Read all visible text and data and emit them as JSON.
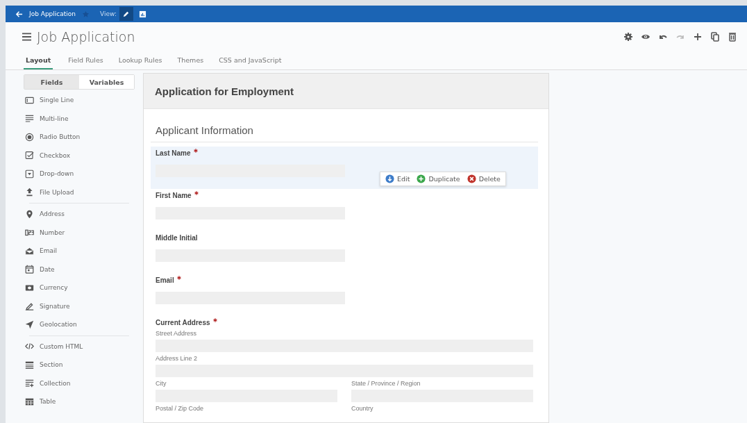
{
  "top_bar": {
    "back_label": "Job Application",
    "view_label": "View:",
    "views": [
      {
        "kind": "edit",
        "selected": true
      },
      {
        "kind": "report",
        "selected": false
      }
    ]
  },
  "header": {
    "title": "Job Application",
    "tools": [
      {
        "kind": "settings",
        "disabled": false
      },
      {
        "kind": "preview",
        "disabled": false
      },
      {
        "kind": "undo",
        "disabled": false
      },
      {
        "kind": "redo",
        "disabled": true
      },
      {
        "kind": "add",
        "disabled": false
      },
      {
        "kind": "copy",
        "disabled": false
      },
      {
        "kind": "delete",
        "disabled": false
      }
    ]
  },
  "tabs": [
    {
      "label": "Layout",
      "selected": true
    },
    {
      "label": "Field Rules",
      "selected": false
    },
    {
      "label": "Lookup Rules",
      "selected": false
    },
    {
      "label": "Themes",
      "selected": false
    },
    {
      "label": "CSS and JavaScript",
      "selected": false
    }
  ],
  "palette": {
    "tabs": [
      {
        "label": "Fields",
        "selected": true
      },
      {
        "label": "Variables",
        "selected": false
      }
    ],
    "groups": [
      [
        {
          "kind": "single",
          "label": "Single Line"
        },
        {
          "kind": "multi",
          "label": "Multi-line"
        },
        {
          "kind": "radio",
          "label": "Radio Button"
        },
        {
          "kind": "checkbox",
          "label": "Checkbox"
        },
        {
          "kind": "dropdown",
          "label": "Drop-down"
        },
        {
          "kind": "upload",
          "label": "File Upload"
        }
      ],
      [
        {
          "kind": "address",
          "label": "Address"
        },
        {
          "kind": "number",
          "label": "Number"
        },
        {
          "kind": "email",
          "label": "Email"
        },
        {
          "kind": "date",
          "label": "Date"
        },
        {
          "kind": "currency",
          "label": "Currency"
        },
        {
          "kind": "signature",
          "label": "Signature"
        },
        {
          "kind": "geo",
          "label": "Geolocation"
        }
      ],
      [
        {
          "kind": "html",
          "label": "Custom HTML"
        },
        {
          "kind": "section",
          "label": "Section"
        },
        {
          "kind": "collection",
          "label": "Collection"
        },
        {
          "kind": "table",
          "label": "Table"
        }
      ]
    ]
  },
  "form": {
    "title": "Application for Employment",
    "section": "Applicant Information",
    "fields": [
      {
        "kind": "text",
        "label": "Last Name",
        "required": true,
        "highlighted": true
      },
      {
        "kind": "text",
        "label": "First Name",
        "required": true,
        "highlighted": false
      },
      {
        "kind": "text",
        "label": "Middle Initial",
        "required": false,
        "highlighted": false
      },
      {
        "kind": "text",
        "label": "Email",
        "required": true,
        "highlighted": false
      },
      {
        "kind": "address",
        "label": "Current Address",
        "required": true,
        "highlighted": false,
        "rows": [
          [
            "Street Address"
          ],
          [
            "Address Line 2"
          ],
          [
            "City",
            "State / Province / Region"
          ],
          [
            "Postal / Zip Code",
            "Country"
          ]
        ]
      }
    ],
    "actions": [
      {
        "kind": "edit",
        "label": "Edit",
        "color": "#3d7cc9"
      },
      {
        "kind": "duplicate",
        "label": "Duplicate",
        "color": "#3aa64a"
      },
      {
        "kind": "delete",
        "label": "Delete",
        "color": "#c0332b"
      }
    ]
  }
}
